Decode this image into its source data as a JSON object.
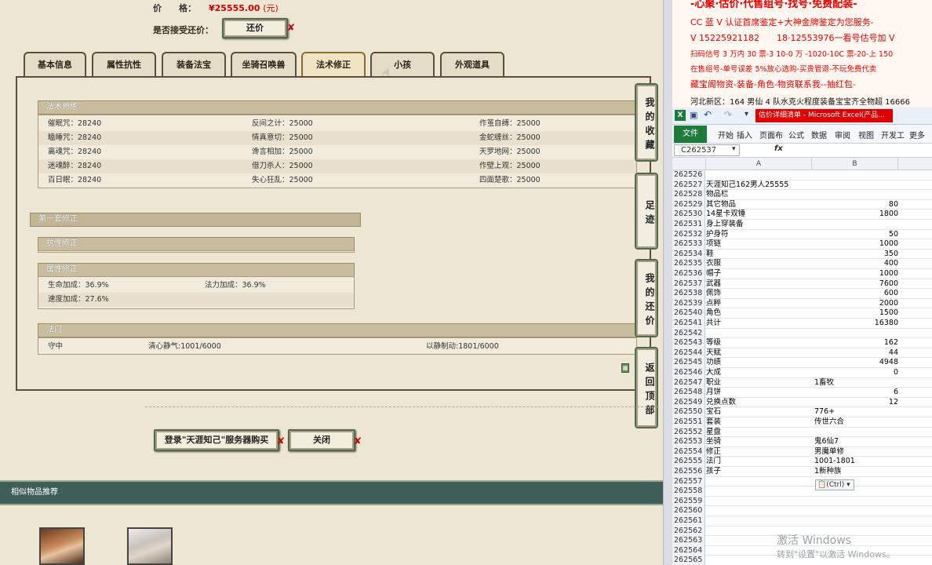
{
  "listing": {
    "price_label": "价　　格：",
    "price_value": "¥25555.00",
    "price_unit": "(元)",
    "accept_bargain_label": "是否接受还价：",
    "bargain_button": "还价"
  },
  "tabs": [
    {
      "label": "基本信息"
    },
    {
      "label": "属性抗性"
    },
    {
      "label": "装备法宝"
    },
    {
      "label": "坐骑召唤兽"
    },
    {
      "label": "法术修正"
    },
    {
      "label": "小孩"
    },
    {
      "label": "外观道具"
    }
  ],
  "spell_skill": {
    "header": "法术熟练",
    "rows": [
      [
        "催眠咒：28240",
        "反间之计：25000",
        "作茧自缚：25000"
      ],
      [
        "瞌睡咒：28240",
        "情真意切：25000",
        "金蛇缠丝：25000"
      ],
      [
        "离魂咒：28240",
        "谗言相加：25000",
        "天罗地网：25000"
      ],
      [
        "迷魂醉：28240",
        "借刀杀人：25000",
        "作壁上观：25000"
      ],
      [
        "百日眠：28240",
        "失心狂乱：25000",
        "四面楚歌：25000"
      ]
    ]
  },
  "first_set": {
    "header": "第一套修正",
    "resist_header": "抗性修正",
    "attr_header": "属性修正",
    "attr_rows": [
      [
        "生命加成：36.9%",
        "法力加成：36.9%"
      ],
      [
        "速度加成：27.6%",
        ""
      ]
    ]
  },
  "school": {
    "header": "法门",
    "row": [
      "守中",
      "清心静气:1001/6000",
      "以静制动:1801/6000"
    ]
  },
  "side_buttons": [
    "我的收藏",
    "足迹",
    "我的还价",
    "返回顶部"
  ],
  "bottom_buttons": {
    "login": "登录\"天涯知己\"服务器购买",
    "close": "关闭"
  },
  "similar_header": "相似物品推荐",
  "right_ad": {
    "line1": "-心聚·估价·代售组号·找号·免费配装-",
    "line2": "CC 蓝 V 认证首席鉴定+大神金牌鉴定为您服务-",
    "line3": "V 15225921182　　18·12553976一看号估号加 V",
    "line4": "扫码估号 3 万内 30 票-3 10-0 万 -1020-10C 票-20-上 150",
    "line5": "在售组号-单号误差 5%放心选购-买贵管退-不玩免费代卖",
    "line6": "藏宝阁物资-装备-角色-物资联系我--抽红包-",
    "line7": "河北新区：164 男仙 4 队水克火程度装备宝宝齐全物超 16666"
  },
  "excel": {
    "title": "估价详细清单 - Microsoft Excel(产品...",
    "ribbon_tabs": [
      "文件",
      "开始",
      "插入",
      "页面布",
      "公式",
      "数据",
      "审阅",
      "视图",
      "开发工",
      "更多工"
    ],
    "name_box": "C262537",
    "fx": "fx",
    "col_a": "A",
    "col_b": "B",
    "ctrl_tag": "(Ctrl)",
    "rows": [
      {
        "n": "262526",
        "a": "",
        "b": ""
      },
      {
        "n": "262527",
        "a": "天涯知己162男人25555",
        "b": ""
      },
      {
        "n": "262528",
        "a": "物品栏",
        "b": ""
      },
      {
        "n": "262529",
        "a": "其它物品",
        "b": "80"
      },
      {
        "n": "262530",
        "a": "14星卡双锤",
        "b": "1800"
      },
      {
        "n": "262531",
        "a": "身上穿装备",
        "b": ""
      },
      {
        "n": "262532",
        "a": "护身符",
        "b": "50"
      },
      {
        "n": "262533",
        "a": "项链",
        "b": "1000"
      },
      {
        "n": "262534",
        "a": "鞋",
        "b": "350"
      },
      {
        "n": "262535",
        "a": "衣服",
        "b": "400"
      },
      {
        "n": "262536",
        "a": "帽子",
        "b": "1000"
      },
      {
        "n": "262537",
        "a": "武器",
        "b": "7600"
      },
      {
        "n": "262538",
        "a": "佩饰",
        "b": "600"
      },
      {
        "n": "262539",
        "a": "点粹",
        "b": "2000"
      },
      {
        "n": "262540",
        "a": "角色",
        "b": "1500"
      },
      {
        "n": "262541",
        "a": "共计",
        "b": "16380"
      },
      {
        "n": "262542",
        "a": "",
        "b": ""
      },
      {
        "n": "262543",
        "a": "等级",
        "b": "162"
      },
      {
        "n": "262544",
        "a": "天赋",
        "b": "44"
      },
      {
        "n": "262545",
        "a": "功绩",
        "b": "4948"
      },
      {
        "n": "262546",
        "a": "大成",
        "b": "0"
      },
      {
        "n": "262547",
        "a": "职业",
        "b": "1畜牧",
        "t": 1
      },
      {
        "n": "262548",
        "a": "月饼",
        "b": "6"
      },
      {
        "n": "262549",
        "a": "兑换点数",
        "b": "12"
      },
      {
        "n": "262550",
        "a": "宝石",
        "b": "776+",
        "t": 1
      },
      {
        "n": "262551",
        "a": "套装",
        "b": "传世六合",
        "t": 1
      },
      {
        "n": "262552",
        "a": "星盘",
        "b": ""
      },
      {
        "n": "262553",
        "a": "坐骑",
        "b": "鬼6仙7",
        "t": 1
      },
      {
        "n": "262554",
        "a": "修正",
        "b": "男魔单修",
        "t": 1
      },
      {
        "n": "262555",
        "a": "法门",
        "b": "1001-1801",
        "t": 1
      },
      {
        "n": "262556",
        "a": "孩子",
        "b": "1新种族",
        "t": 1
      },
      {
        "n": "262557",
        "a": "",
        "b": ""
      },
      {
        "n": "262558",
        "a": "",
        "b": ""
      },
      {
        "n": "262559",
        "a": "",
        "b": ""
      },
      {
        "n": "262560",
        "a": "",
        "b": ""
      },
      {
        "n": "262561",
        "a": "",
        "b": ""
      },
      {
        "n": "262562",
        "a": "",
        "b": ""
      },
      {
        "n": "262563",
        "a": "",
        "b": ""
      },
      {
        "n": "262564",
        "a": "",
        "b": ""
      },
      {
        "n": "262565",
        "a": "",
        "b": ""
      }
    ]
  },
  "watermark": {
    "line1": "激活 Windows",
    "line2": "转到\"设置\"以激活 Windows。"
  }
}
